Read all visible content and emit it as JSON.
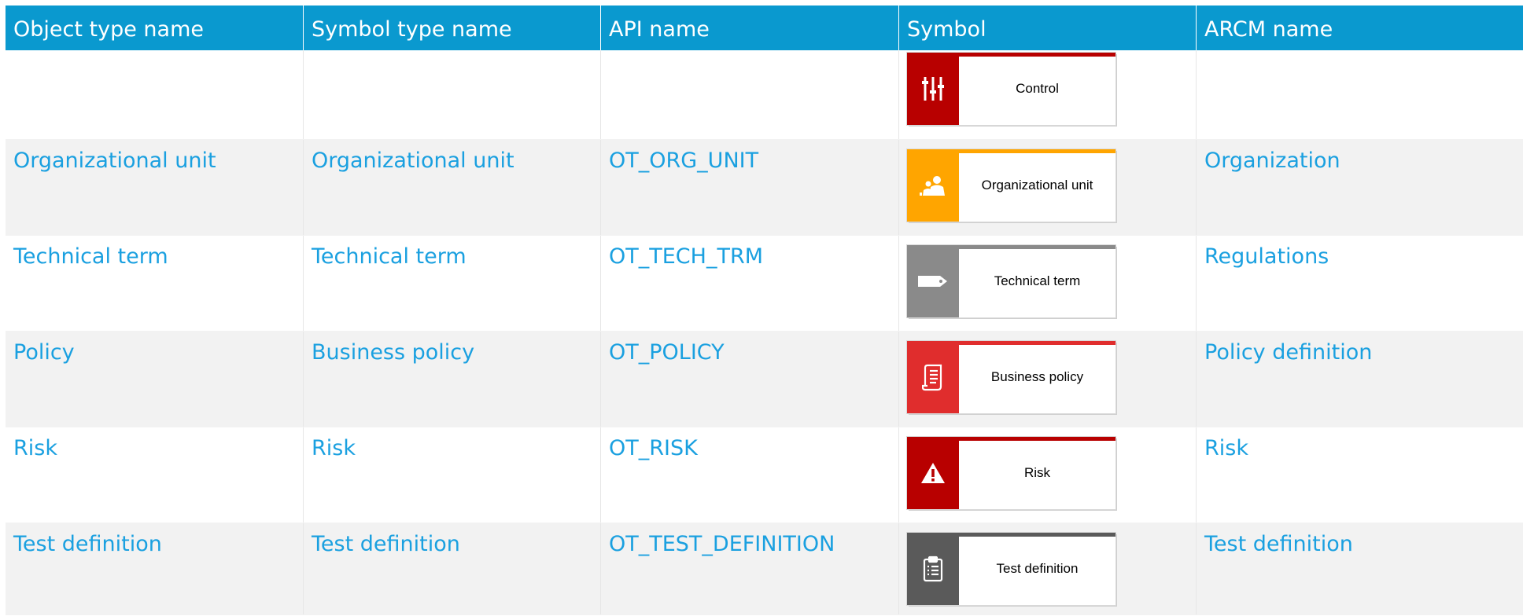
{
  "headers": [
    "Object type name",
    "Symbol type name",
    "API name",
    "Symbol",
    "ARCM name"
  ],
  "rows": [
    {
      "object_type": "",
      "symbol_type": "",
      "api_name": "",
      "symbol_label": "Control",
      "symbol_icon": "sliders-icon",
      "symbol_color": "#b80000",
      "arcm_name": ""
    },
    {
      "object_type": "Organizational unit",
      "symbol_type": "Organizational unit",
      "api_name": "OT_ORG_UNIT",
      "symbol_label": "Organizational unit",
      "symbol_icon": "people-icon",
      "symbol_color": "#ffa500",
      "arcm_name": "Organization"
    },
    {
      "object_type": "Technical term",
      "symbol_type": "Technical term",
      "api_name": "OT_TECH_TRM",
      "symbol_label": "Technical term",
      "symbol_icon": "tag-icon",
      "symbol_color": "#8a8a8a",
      "arcm_name": "Regulations"
    },
    {
      "object_type": "Policy",
      "symbol_type": "Business policy",
      "api_name": "OT_POLICY",
      "symbol_label": "Business policy",
      "symbol_icon": "scroll-icon",
      "symbol_color": "#e02d2d",
      "arcm_name": "Policy definition"
    },
    {
      "object_type": "Risk",
      "symbol_type": "Risk",
      "api_name": "OT_RISK",
      "symbol_label": "Risk",
      "symbol_icon": "warning-icon",
      "symbol_color": "#b80000",
      "arcm_name": "Risk"
    },
    {
      "object_type": "Test definition",
      "symbol_type": "Test definition",
      "api_name": "OT_TEST_DEFINITION",
      "symbol_label": "Test definition",
      "symbol_icon": "clipboard-icon",
      "symbol_color": "#5a5a5a",
      "arcm_name": "Test definition"
    }
  ]
}
